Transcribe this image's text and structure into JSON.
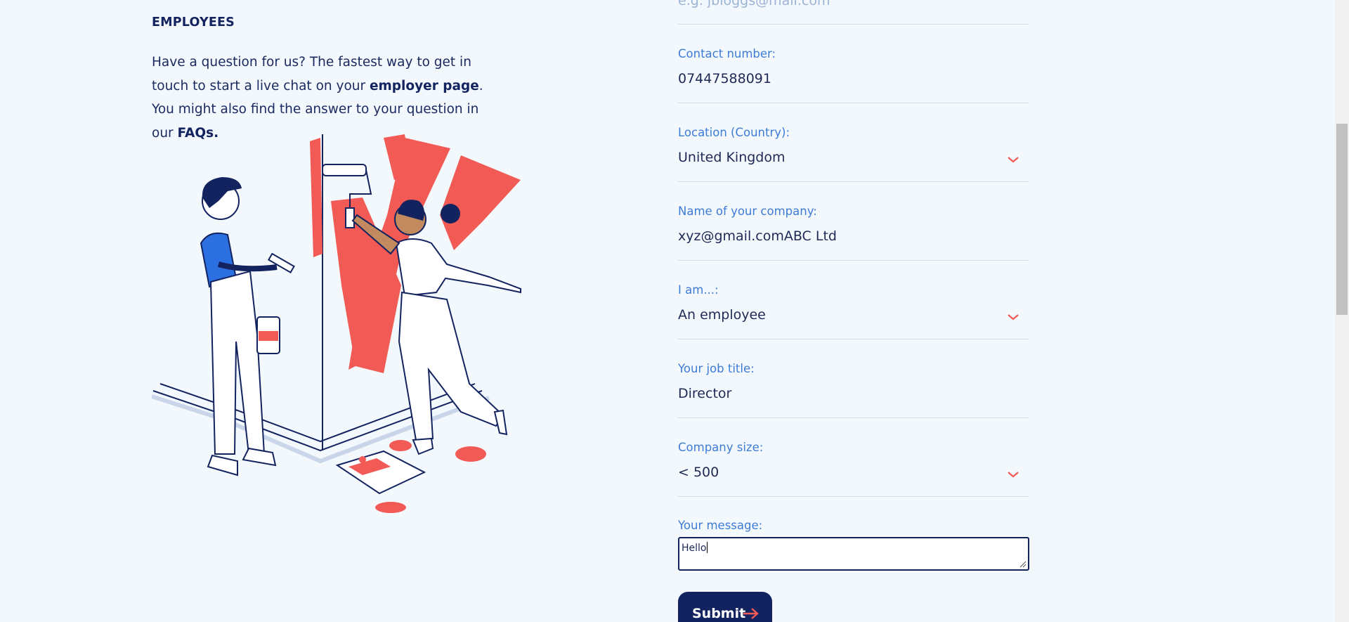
{
  "left": {
    "heading": "EMPLOYEES",
    "intro_part1": "Have a question for us? The fastest way to get in touch to start a live chat on your ",
    "intro_link1": "employer page",
    "intro_part2": ". You might also find the answer to your question in our ",
    "intro_link2": "FAQs."
  },
  "form": {
    "email_placeholder": "e.g. jbloggs@mail.com",
    "contact_label": "Contact number:",
    "contact_value": "07447588091",
    "location_label": "Location (Country):",
    "location_value": "United Kingdom",
    "company_label": "Name of your company:",
    "company_value": "xyz@gmail.comABC Ltd",
    "iam_label": "I am...:",
    "iam_value": "An employee",
    "job_label": "Your job title:",
    "job_value": "Director",
    "size_label": "Company size:",
    "size_value": "< 500",
    "message_label": "Your message:",
    "message_value": "Hello",
    "submit_label": "Submit"
  },
  "colors": {
    "navy": "#13235f",
    "label_blue": "#3d7cd6",
    "accent_red": "#f25a55",
    "background": "#f3f8fd"
  }
}
